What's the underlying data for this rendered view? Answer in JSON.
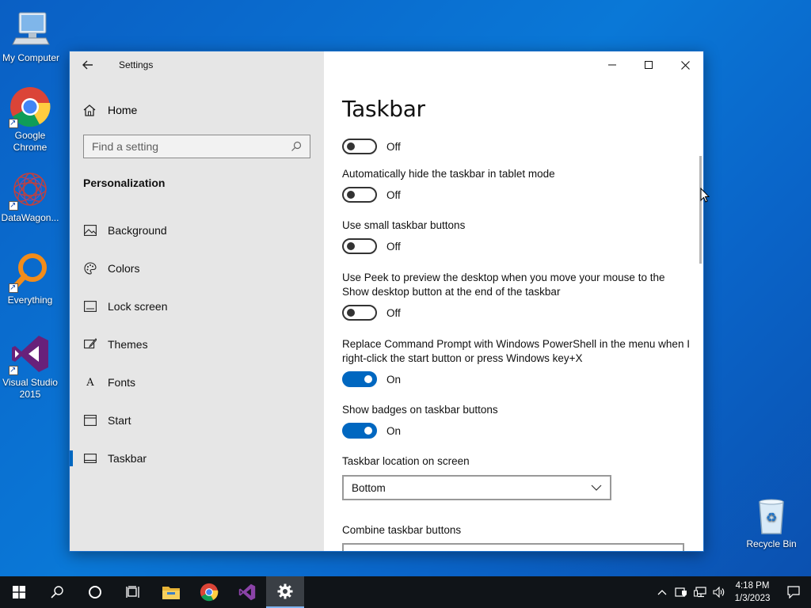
{
  "desktop": {
    "icons": [
      {
        "label": "My Computer"
      },
      {
        "label": "Google Chrome"
      },
      {
        "label": "DataWagon..."
      },
      {
        "label": "Everything"
      },
      {
        "label": "Visual Studio 2015"
      },
      {
        "label": "Recycle Bin"
      }
    ]
  },
  "window": {
    "title": "Settings",
    "sidebar": {
      "home_label": "Home",
      "search_placeholder": "Find a setting",
      "section_heading": "Personalization",
      "items": [
        {
          "label": "Background",
          "icon": "picture-icon"
        },
        {
          "label": "Colors",
          "icon": "palette-icon"
        },
        {
          "label": "Lock screen",
          "icon": "lock-screen-icon"
        },
        {
          "label": "Themes",
          "icon": "brush-icon"
        },
        {
          "label": "Fonts",
          "icon": "fonts-icon"
        },
        {
          "label": "Start",
          "icon": "start-icon"
        },
        {
          "label": "Taskbar",
          "icon": "taskbar-icon",
          "active": true
        }
      ]
    },
    "content": {
      "title": "Taskbar",
      "settings": [
        {
          "label": "",
          "state": "Off"
        },
        {
          "label": "Automatically hide the taskbar in tablet mode",
          "state": "Off"
        },
        {
          "label": "Use small taskbar buttons",
          "state": "Off"
        },
        {
          "label": "Use Peek to preview the desktop when you move your mouse to the Show desktop button at the end of the taskbar",
          "state": "Off"
        },
        {
          "label": "Replace Command Prompt with Windows PowerShell in the menu when I right-click the start button or press Windows key+X",
          "state": "On"
        },
        {
          "label": "Show badges on taskbar buttons",
          "state": "On"
        }
      ],
      "location_label": "Taskbar location on screen",
      "location_value": "Bottom",
      "combine_label": "Combine taskbar buttons"
    }
  },
  "taskbar": {
    "clock_time": "4:18 PM",
    "clock_date": "1/3/2023",
    "accent": "#0067c0"
  }
}
